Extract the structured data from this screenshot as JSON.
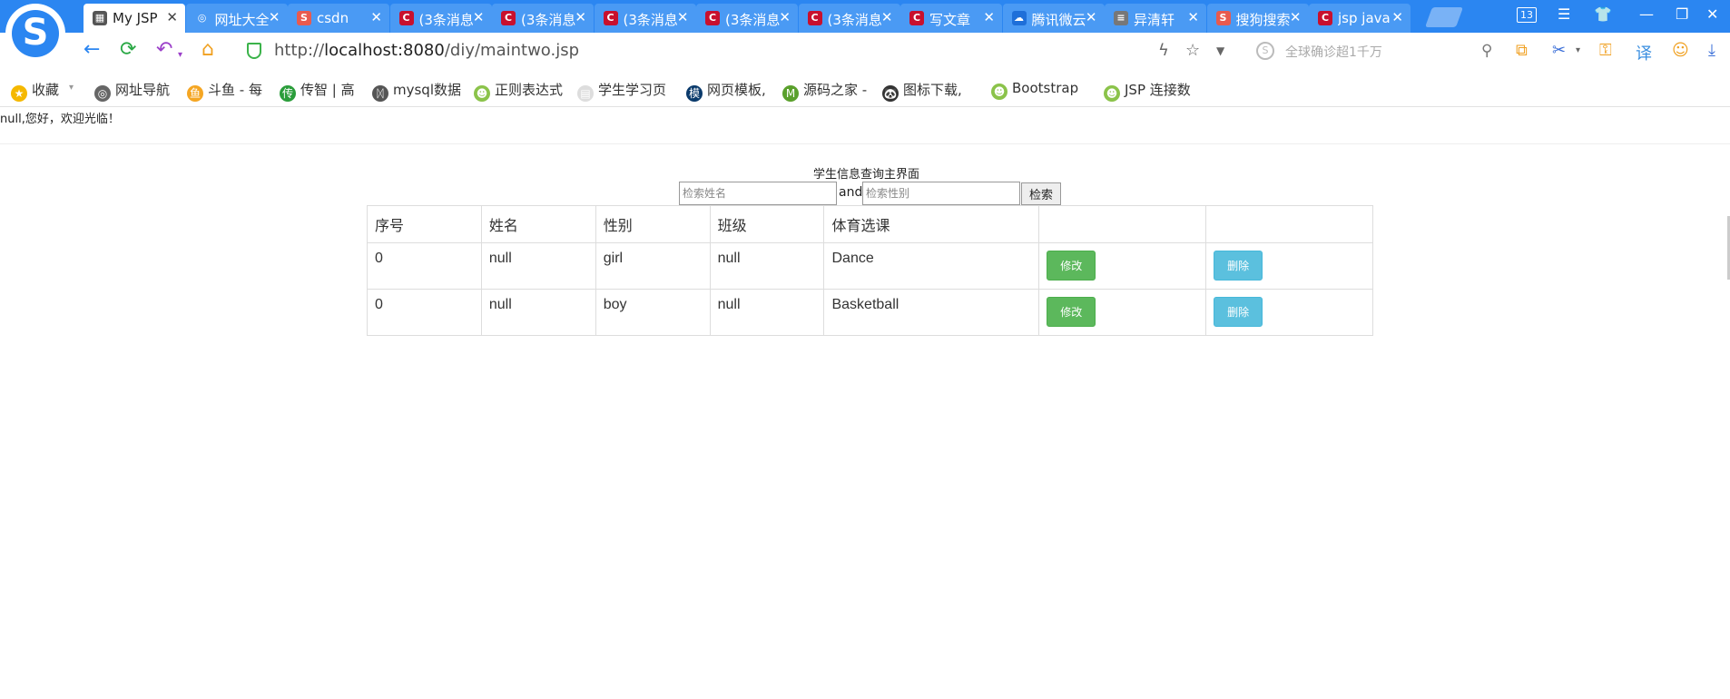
{
  "browser": {
    "tab_count": "13",
    "tabs": [
      {
        "label": "My JSP",
        "active": true,
        "icon_color": "#555555",
        "icon": "page-icon"
      },
      {
        "label": "网址大全",
        "icon_color": "#4a9af4",
        "icon": "globe-icon"
      },
      {
        "label": "csdn",
        "icon_color": "#e85a4f",
        "icon": "sogou-icon"
      },
      {
        "label": "(3条消息",
        "icon_color": "#c8102e",
        "icon": "csdn-icon"
      },
      {
        "label": "(3条消息",
        "icon_color": "#c8102e",
        "icon": "csdn-icon"
      },
      {
        "label": "(3条消息",
        "icon_color": "#c8102e",
        "icon": "csdn-icon"
      },
      {
        "label": "(3条消息",
        "icon_color": "#c8102e",
        "icon": "csdn-icon"
      },
      {
        "label": "(3条消息",
        "icon_color": "#c8102e",
        "icon": "csdn-icon"
      },
      {
        "label": "写文章",
        "icon_color": "#c8102e",
        "icon": "csdn-icon"
      },
      {
        "label": "腾讯微云",
        "icon_color": "#1e6fd9",
        "icon": "cloud-icon"
      },
      {
        "label": "异清轩",
        "icon_color": "#777777",
        "icon": "doc-icon"
      },
      {
        "label": "搜狗搜索",
        "icon_color": "#e85a4f",
        "icon": "sogou-icon"
      },
      {
        "label": "jsp java",
        "icon_color": "#c8102e",
        "icon": "csdn-icon"
      }
    ],
    "url_prefix": "http://",
    "url_host": "localhost:8080",
    "url_path": "/diy/maintwo.jsp",
    "search_placeholder": "全球确诊超1千万",
    "bookmarks": [
      {
        "label": "收藏",
        "icon": "star-icon",
        "color": "#f5b800"
      },
      {
        "label": "网址导航",
        "icon": "globe-icon",
        "color": "#666666"
      },
      {
        "label": "斗鱼 - 每",
        "icon": "douyu-icon",
        "color": "#f5a623"
      },
      {
        "label": "传智 | 高",
        "icon": "itcast-icon",
        "color": "#2a9d3a"
      },
      {
        "label": "mysql数据",
        "icon": "mysql-icon",
        "color": "#555555"
      },
      {
        "label": "正则表达式",
        "icon": "frog-icon",
        "color": "#8bc34a"
      },
      {
        "label": "学生学习页",
        "icon": "page-icon",
        "color": "#dddddd"
      },
      {
        "label": "网页模板,",
        "icon": "template-icon",
        "color": "#0a3a6b"
      },
      {
        "label": "源码之家 -",
        "icon": "m-icon",
        "color": "#5aa02c"
      },
      {
        "label": "图标下载,",
        "icon": "panda-icon",
        "color": "#333333"
      },
      {
        "label": "Bootstrap",
        "icon": "frog-icon",
        "color": "#8bc34a"
      },
      {
        "label": "JSP 连接数",
        "icon": "frog-icon",
        "color": "#8bc34a"
      }
    ]
  },
  "page": {
    "welcome": "null,您好，欢迎光临！",
    "title": "学生信息查询主界面",
    "search_name_placeholder": "检索姓名",
    "and_text": "and",
    "search_gender_placeholder": "检索性别",
    "search_button": "检索",
    "table": {
      "headers": [
        "序号",
        "姓名",
        "性别",
        "班级",
        "体育选课"
      ],
      "rows": [
        {
          "id": "0",
          "name": "null",
          "gender": "girl",
          "class": "null",
          "sport": "Dance",
          "edit": "修改",
          "delete": "删除"
        },
        {
          "id": "0",
          "name": "null",
          "gender": "boy",
          "class": "null",
          "sport": "Basketball",
          "edit": "修改",
          "delete": "删除"
        }
      ]
    }
  }
}
